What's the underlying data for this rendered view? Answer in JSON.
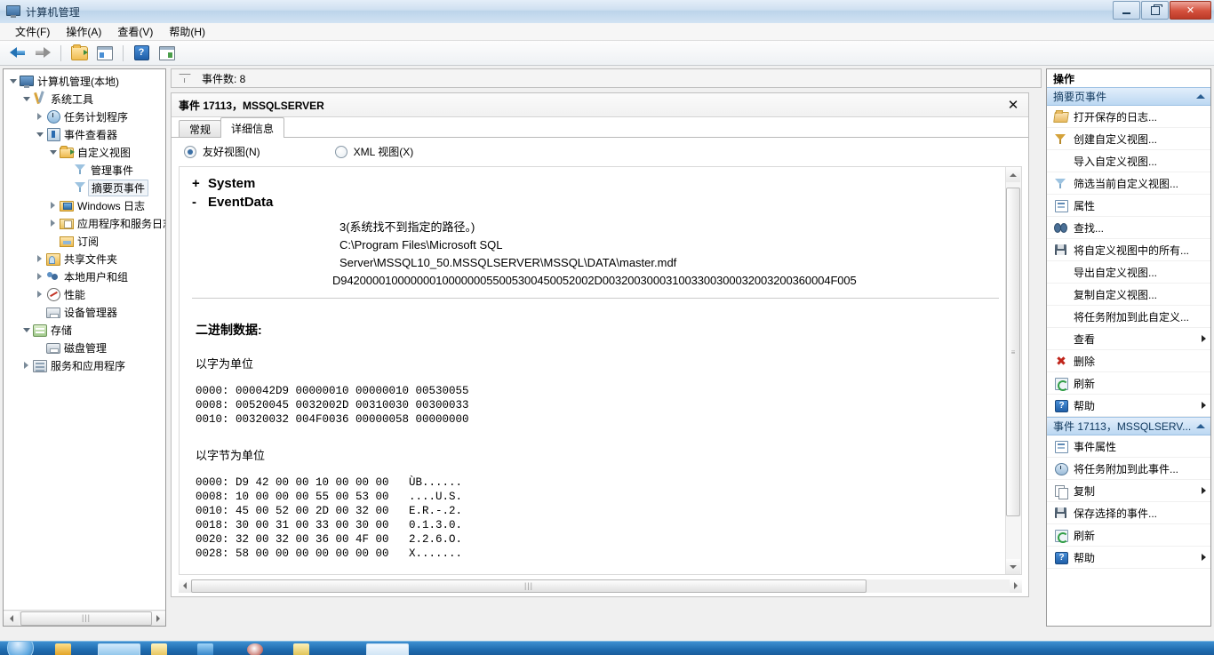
{
  "window": {
    "title": "计算机管理",
    "icon": "computer-management-icon",
    "controls": {
      "minimize": "—",
      "maximize": "❐",
      "close": "✕"
    }
  },
  "menu": [
    {
      "label": "文件(F)"
    },
    {
      "label": "操作(A)"
    },
    {
      "label": "查看(V)"
    },
    {
      "label": "帮助(H)"
    }
  ],
  "toolbar": [
    {
      "name": "back-arrow-icon",
      "label": "后退"
    },
    {
      "name": "forward-arrow-icon",
      "label": "前进"
    },
    {
      "name": "up-folder-icon",
      "label": "向上"
    },
    {
      "name": "show-console-tree-icon",
      "label": "显示/隐藏控制台树"
    },
    {
      "name": "help-icon",
      "label": "帮助"
    },
    {
      "name": "show-action-pane-icon",
      "label": "显示/隐藏操作窗格"
    }
  ],
  "tree": [
    {
      "label": "计算机管理(本地)",
      "indent": 0,
      "expander": "open",
      "icon": "computer-icon",
      "selected": false
    },
    {
      "label": "系统工具",
      "indent": 1,
      "expander": "open",
      "icon": "system-tools-icon",
      "selected": false
    },
    {
      "label": "任务计划程序",
      "indent": 2,
      "expander": "closed",
      "icon": "task-scheduler-icon",
      "selected": false
    },
    {
      "label": "事件查看器",
      "indent": 2,
      "expander": "open",
      "icon": "event-viewer-icon",
      "selected": false
    },
    {
      "label": "自定义视图",
      "indent": 3,
      "expander": "open",
      "icon": "custom-views-folder-icon",
      "selected": false
    },
    {
      "label": "管理事件",
      "indent": 4,
      "expander": "none",
      "icon": "filter-funnel-icon",
      "selected": false
    },
    {
      "label": "摘要页事件",
      "indent": 4,
      "expander": "none",
      "icon": "filter-funnel-icon",
      "selected": true
    },
    {
      "label": "Windows 日志",
      "indent": 3,
      "expander": "closed",
      "icon": "windows-logs-folder-icon",
      "selected": false
    },
    {
      "label": "应用程序和服务日志",
      "indent": 3,
      "expander": "closed",
      "icon": "app-service-logs-folder-icon",
      "selected": false
    },
    {
      "label": "订阅",
      "indent": 3,
      "expander": "none",
      "icon": "subscriptions-folder-icon",
      "selected": false
    },
    {
      "label": "共享文件夹",
      "indent": 2,
      "expander": "closed",
      "icon": "shared-folders-icon",
      "selected": false
    },
    {
      "label": "本地用户和组",
      "indent": 2,
      "expander": "closed",
      "icon": "local-users-groups-icon",
      "selected": false
    },
    {
      "label": "性能",
      "indent": 2,
      "expander": "closed",
      "icon": "performance-icon",
      "selected": false
    },
    {
      "label": "设备管理器",
      "indent": 2,
      "expander": "none",
      "icon": "device-manager-icon",
      "selected": false
    },
    {
      "label": "存储",
      "indent": 1,
      "expander": "open",
      "icon": "storage-icon",
      "selected": false
    },
    {
      "label": "磁盘管理",
      "indent": 2,
      "expander": "none",
      "icon": "disk-management-icon",
      "selected": false
    },
    {
      "label": "服务和应用程序",
      "indent": 1,
      "expander": "closed",
      "icon": "services-apps-icon",
      "selected": false
    }
  ],
  "center": {
    "event_count_label": "事件数: 8",
    "detail_title": "事件 17113，MSSQLSERVER",
    "close_label": "✕",
    "tabs": [
      {
        "label": "常规",
        "active": false
      },
      {
        "label": "详细信息",
        "active": true
      }
    ],
    "view_modes": [
      {
        "label": "友好视图(N)",
        "selected": true
      },
      {
        "label": "XML 视图(X)",
        "selected": false
      }
    ],
    "xml_nodes": [
      {
        "sign": "+",
        "label": "System"
      },
      {
        "sign": "-",
        "label": "EventData"
      }
    ],
    "event_data_lines": [
      "3(系统找不到指定的路径。)",
      "C:\\Program Files\\Microsoft SQL",
      "Server\\MSSQL10_50.MSSQLSERVER\\MSSQL\\DATA\\master.mdf"
    ],
    "event_data_hex": "D9420000100000001000000055005300450052002D003200300031003300300032003200360004F005",
    "binary_header": "二进制数据:",
    "words_label": "以字为单位",
    "words_dump": "0000: 000042D9 00000010 00000010 00530055\n0008: 00520045 0032002D 00310030 00300033\n0010: 00320032 004F0036 00000058 00000000",
    "bytes_label": "以字节为单位",
    "bytes_dump": "0000: D9 42 00 00 10 00 00 00   ÙB......\n0008: 10 00 00 00 55 00 53 00   ....U.S.\n0010: 45 00 52 00 2D 00 32 00   E.R.-.2.\n0018: 30 00 31 00 33 00 30 00   0.1.3.0.\n0020: 32 00 32 00 36 00 4F 00   2.2.6.O.\n0028: 58 00 00 00 00 00 00 00   X......."
  },
  "actions": {
    "header": "操作",
    "groups": [
      {
        "title": "摘要页事件",
        "collapse_icon": "chevron-up-icon",
        "items": [
          {
            "label": "打开保存的日志...",
            "icon": "open-saved-log-icon",
            "submenu": false
          },
          {
            "label": "创建自定义视图...",
            "icon": "create-custom-view-icon",
            "submenu": false
          },
          {
            "label": "导入自定义视图...",
            "icon": "none",
            "submenu": false
          },
          {
            "label": "筛选当前自定义视图...",
            "icon": "filter-icon",
            "submenu": false
          },
          {
            "label": "属性",
            "icon": "properties-icon",
            "submenu": false
          },
          {
            "label": "查找...",
            "icon": "find-icon",
            "submenu": false
          },
          {
            "label": "将自定义视图中的所有...",
            "icon": "save-icon",
            "submenu": false
          },
          {
            "label": "导出自定义视图...",
            "icon": "none",
            "submenu": false
          },
          {
            "label": "复制自定义视图...",
            "icon": "none",
            "submenu": false
          },
          {
            "label": "将任务附加到此自定义...",
            "icon": "none",
            "submenu": false
          },
          {
            "label": "查看",
            "icon": "none",
            "submenu": true
          },
          {
            "label": "删除",
            "icon": "delete-icon",
            "submenu": false
          },
          {
            "label": "刷新",
            "icon": "refresh-icon",
            "submenu": false
          },
          {
            "label": "帮助",
            "icon": "help-icon",
            "submenu": true
          }
        ]
      },
      {
        "title": "事件 17113，MSSQLSERV...",
        "collapse_icon": "chevron-up-icon",
        "items": [
          {
            "label": "事件属性",
            "icon": "properties-icon",
            "submenu": false
          },
          {
            "label": "将任务附加到此事件...",
            "icon": "attach-task-icon",
            "submenu": false
          },
          {
            "label": "复制",
            "icon": "copy-icon",
            "submenu": true
          },
          {
            "label": "保存选择的事件...",
            "icon": "save-icon",
            "submenu": false
          },
          {
            "label": "刷新",
            "icon": "refresh-icon",
            "submenu": false
          },
          {
            "label": "帮助",
            "icon": "help-icon",
            "submenu": true
          }
        ]
      }
    ]
  }
}
